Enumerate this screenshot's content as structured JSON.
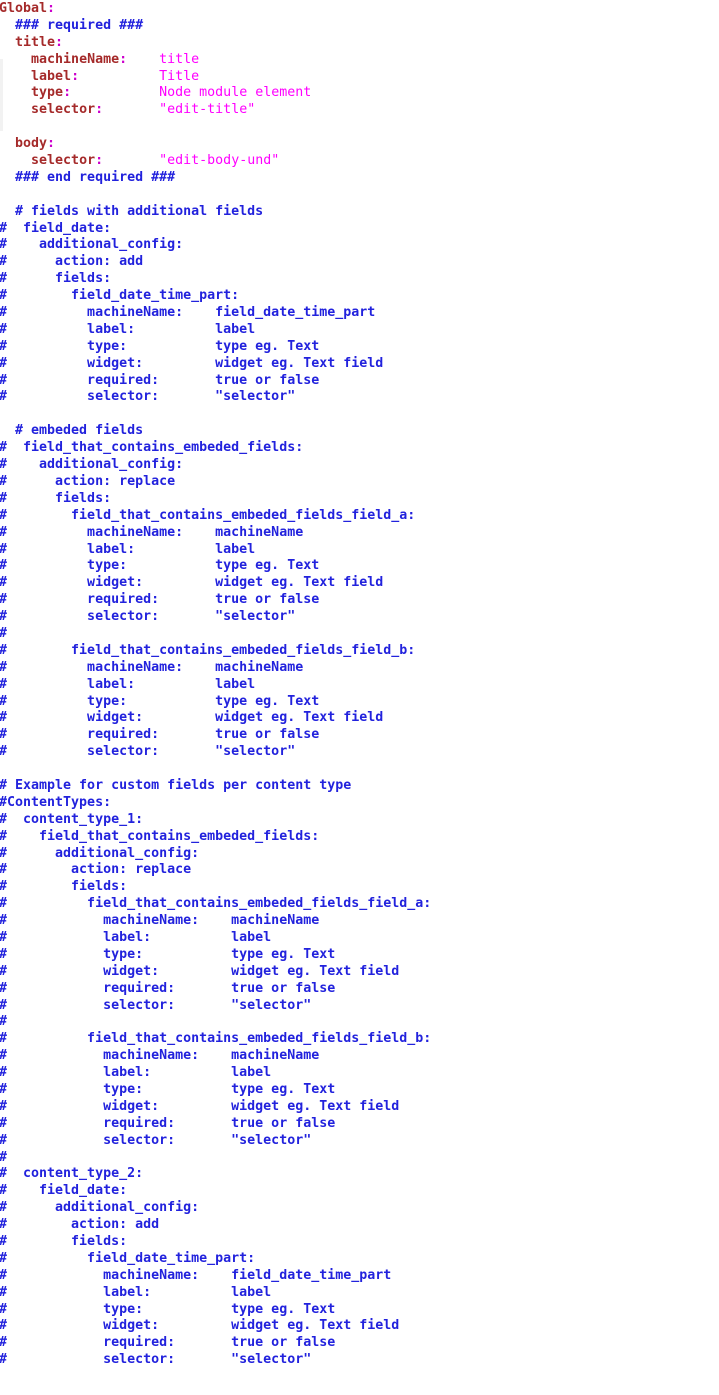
{
  "editor": {
    "language": "yaml",
    "background_color": "#ffffff",
    "colors": {
      "comment": "#2222dd",
      "key": "#a52a2a",
      "punctuation": "#cc00cc",
      "value": "#ff00ff"
    }
  },
  "lines": [
    {
      "i": 0,
      "kind": "key",
      "text": "Global:"
    },
    {
      "i": 1,
      "kind": "comment",
      "text": "  ### required ###"
    },
    {
      "i": 2,
      "kind": "key",
      "text": "  title:"
    },
    {
      "i": 3,
      "kind": "pair",
      "text": "    machineName:    title"
    },
    {
      "i": 4,
      "kind": "pair",
      "text": "    label:          Title"
    },
    {
      "i": 5,
      "kind": "pair",
      "text": "    type:           Node module element"
    },
    {
      "i": 6,
      "kind": "pair",
      "text": "    selector:       \"edit-title\""
    },
    {
      "i": 7,
      "kind": "blank",
      "text": ""
    },
    {
      "i": 8,
      "kind": "key",
      "text": "  body:"
    },
    {
      "i": 9,
      "kind": "pair",
      "text": "    selector:       \"edit-body-und\""
    },
    {
      "i": 10,
      "kind": "comment",
      "text": "  ### end required ###"
    },
    {
      "i": 11,
      "kind": "blank",
      "text": ""
    },
    {
      "i": 12,
      "kind": "comment",
      "text": "  # fields with additional fields"
    },
    {
      "i": 13,
      "kind": "comment",
      "text": "#  field_date:"
    },
    {
      "i": 14,
      "kind": "comment",
      "text": "#    additional_config:"
    },
    {
      "i": 15,
      "kind": "comment",
      "text": "#      action: add"
    },
    {
      "i": 16,
      "kind": "comment",
      "text": "#      fields:"
    },
    {
      "i": 17,
      "kind": "comment",
      "text": "#        field_date_time_part:"
    },
    {
      "i": 18,
      "kind": "comment",
      "text": "#          machineName:    field_date_time_part"
    },
    {
      "i": 19,
      "kind": "comment",
      "text": "#          label:          label"
    },
    {
      "i": 20,
      "kind": "comment",
      "text": "#          type:           type eg. Text"
    },
    {
      "i": 21,
      "kind": "comment",
      "text": "#          widget:         widget eg. Text field"
    },
    {
      "i": 22,
      "kind": "comment",
      "text": "#          required:       true or false"
    },
    {
      "i": 23,
      "kind": "comment",
      "text": "#          selector:       \"selector\""
    },
    {
      "i": 24,
      "kind": "blank",
      "text": ""
    },
    {
      "i": 25,
      "kind": "comment",
      "text": "  # embeded fields"
    },
    {
      "i": 26,
      "kind": "comment",
      "text": "#  field_that_contains_embeded_fields:"
    },
    {
      "i": 27,
      "kind": "comment",
      "text": "#    additional_config:"
    },
    {
      "i": 28,
      "kind": "comment",
      "text": "#      action: replace"
    },
    {
      "i": 29,
      "kind": "comment",
      "text": "#      fields:"
    },
    {
      "i": 30,
      "kind": "comment",
      "text": "#        field_that_contains_embeded_fields_field_a:"
    },
    {
      "i": 31,
      "kind": "comment",
      "text": "#          machineName:    machineName"
    },
    {
      "i": 32,
      "kind": "comment",
      "text": "#          label:          label"
    },
    {
      "i": 33,
      "kind": "comment",
      "text": "#          type:           type eg. Text"
    },
    {
      "i": 34,
      "kind": "comment",
      "text": "#          widget:         widget eg. Text field"
    },
    {
      "i": 35,
      "kind": "comment",
      "text": "#          required:       true or false"
    },
    {
      "i": 36,
      "kind": "comment",
      "text": "#          selector:       \"selector\""
    },
    {
      "i": 37,
      "kind": "comment",
      "text": "#"
    },
    {
      "i": 38,
      "kind": "comment",
      "text": "#        field_that_contains_embeded_fields_field_b:"
    },
    {
      "i": 39,
      "kind": "comment",
      "text": "#          machineName:    machineName"
    },
    {
      "i": 40,
      "kind": "comment",
      "text": "#          label:          label"
    },
    {
      "i": 41,
      "kind": "comment",
      "text": "#          type:           type eg. Text"
    },
    {
      "i": 42,
      "kind": "comment",
      "text": "#          widget:         widget eg. Text field"
    },
    {
      "i": 43,
      "kind": "comment",
      "text": "#          required:       true or false"
    },
    {
      "i": 44,
      "kind": "comment",
      "text": "#          selector:       \"selector\""
    },
    {
      "i": 45,
      "kind": "blank",
      "text": ""
    },
    {
      "i": 46,
      "kind": "comment",
      "text": "# Example for custom fields per content type"
    },
    {
      "i": 47,
      "kind": "comment",
      "text": "#ContentTypes:"
    },
    {
      "i": 48,
      "kind": "comment",
      "text": "#  content_type_1:"
    },
    {
      "i": 49,
      "kind": "comment",
      "text": "#    field_that_contains_embeded_fields:"
    },
    {
      "i": 50,
      "kind": "comment",
      "text": "#      additional_config:"
    },
    {
      "i": 51,
      "kind": "comment",
      "text": "#        action: replace"
    },
    {
      "i": 52,
      "kind": "comment",
      "text": "#        fields:"
    },
    {
      "i": 53,
      "kind": "comment",
      "text": "#          field_that_contains_embeded_fields_field_a:"
    },
    {
      "i": 54,
      "kind": "comment",
      "text": "#            machineName:    machineName"
    },
    {
      "i": 55,
      "kind": "comment",
      "text": "#            label:          label"
    },
    {
      "i": 56,
      "kind": "comment",
      "text": "#            type:           type eg. Text"
    },
    {
      "i": 57,
      "kind": "comment",
      "text": "#            widget:         widget eg. Text field"
    },
    {
      "i": 58,
      "kind": "comment",
      "text": "#            required:       true or false"
    },
    {
      "i": 59,
      "kind": "comment",
      "text": "#            selector:       \"selector\""
    },
    {
      "i": 60,
      "kind": "comment",
      "text": "#"
    },
    {
      "i": 61,
      "kind": "comment",
      "text": "#          field_that_contains_embeded_fields_field_b:"
    },
    {
      "i": 62,
      "kind": "comment",
      "text": "#            machineName:    machineName"
    },
    {
      "i": 63,
      "kind": "comment",
      "text": "#            label:          label"
    },
    {
      "i": 64,
      "kind": "comment",
      "text": "#            type:           type eg. Text"
    },
    {
      "i": 65,
      "kind": "comment",
      "text": "#            widget:         widget eg. Text field"
    },
    {
      "i": 66,
      "kind": "comment",
      "text": "#            required:       true or false"
    },
    {
      "i": 67,
      "kind": "comment",
      "text": "#            selector:       \"selector\""
    },
    {
      "i": 68,
      "kind": "comment",
      "text": "#"
    },
    {
      "i": 69,
      "kind": "comment",
      "text": "#  content_type_2:"
    },
    {
      "i": 70,
      "kind": "comment",
      "text": "#    field_date:"
    },
    {
      "i": 71,
      "kind": "comment",
      "text": "#      additional_config:"
    },
    {
      "i": 72,
      "kind": "comment",
      "text": "#        action: add"
    },
    {
      "i": 73,
      "kind": "comment",
      "text": "#        fields:"
    },
    {
      "i": 74,
      "kind": "comment",
      "text": "#          field_date_time_part:"
    },
    {
      "i": 75,
      "kind": "comment",
      "text": "#            machineName:    field_date_time_part"
    },
    {
      "i": 76,
      "kind": "comment",
      "text": "#            label:          label"
    },
    {
      "i": 77,
      "kind": "comment",
      "text": "#            type:           type eg. Text"
    },
    {
      "i": 78,
      "kind": "comment",
      "text": "#            widget:         widget eg. Text field"
    },
    {
      "i": 79,
      "kind": "comment",
      "text": "#            required:       true or false"
    },
    {
      "i": 80,
      "kind": "comment",
      "text": "#            selector:       \"selector\""
    }
  ]
}
